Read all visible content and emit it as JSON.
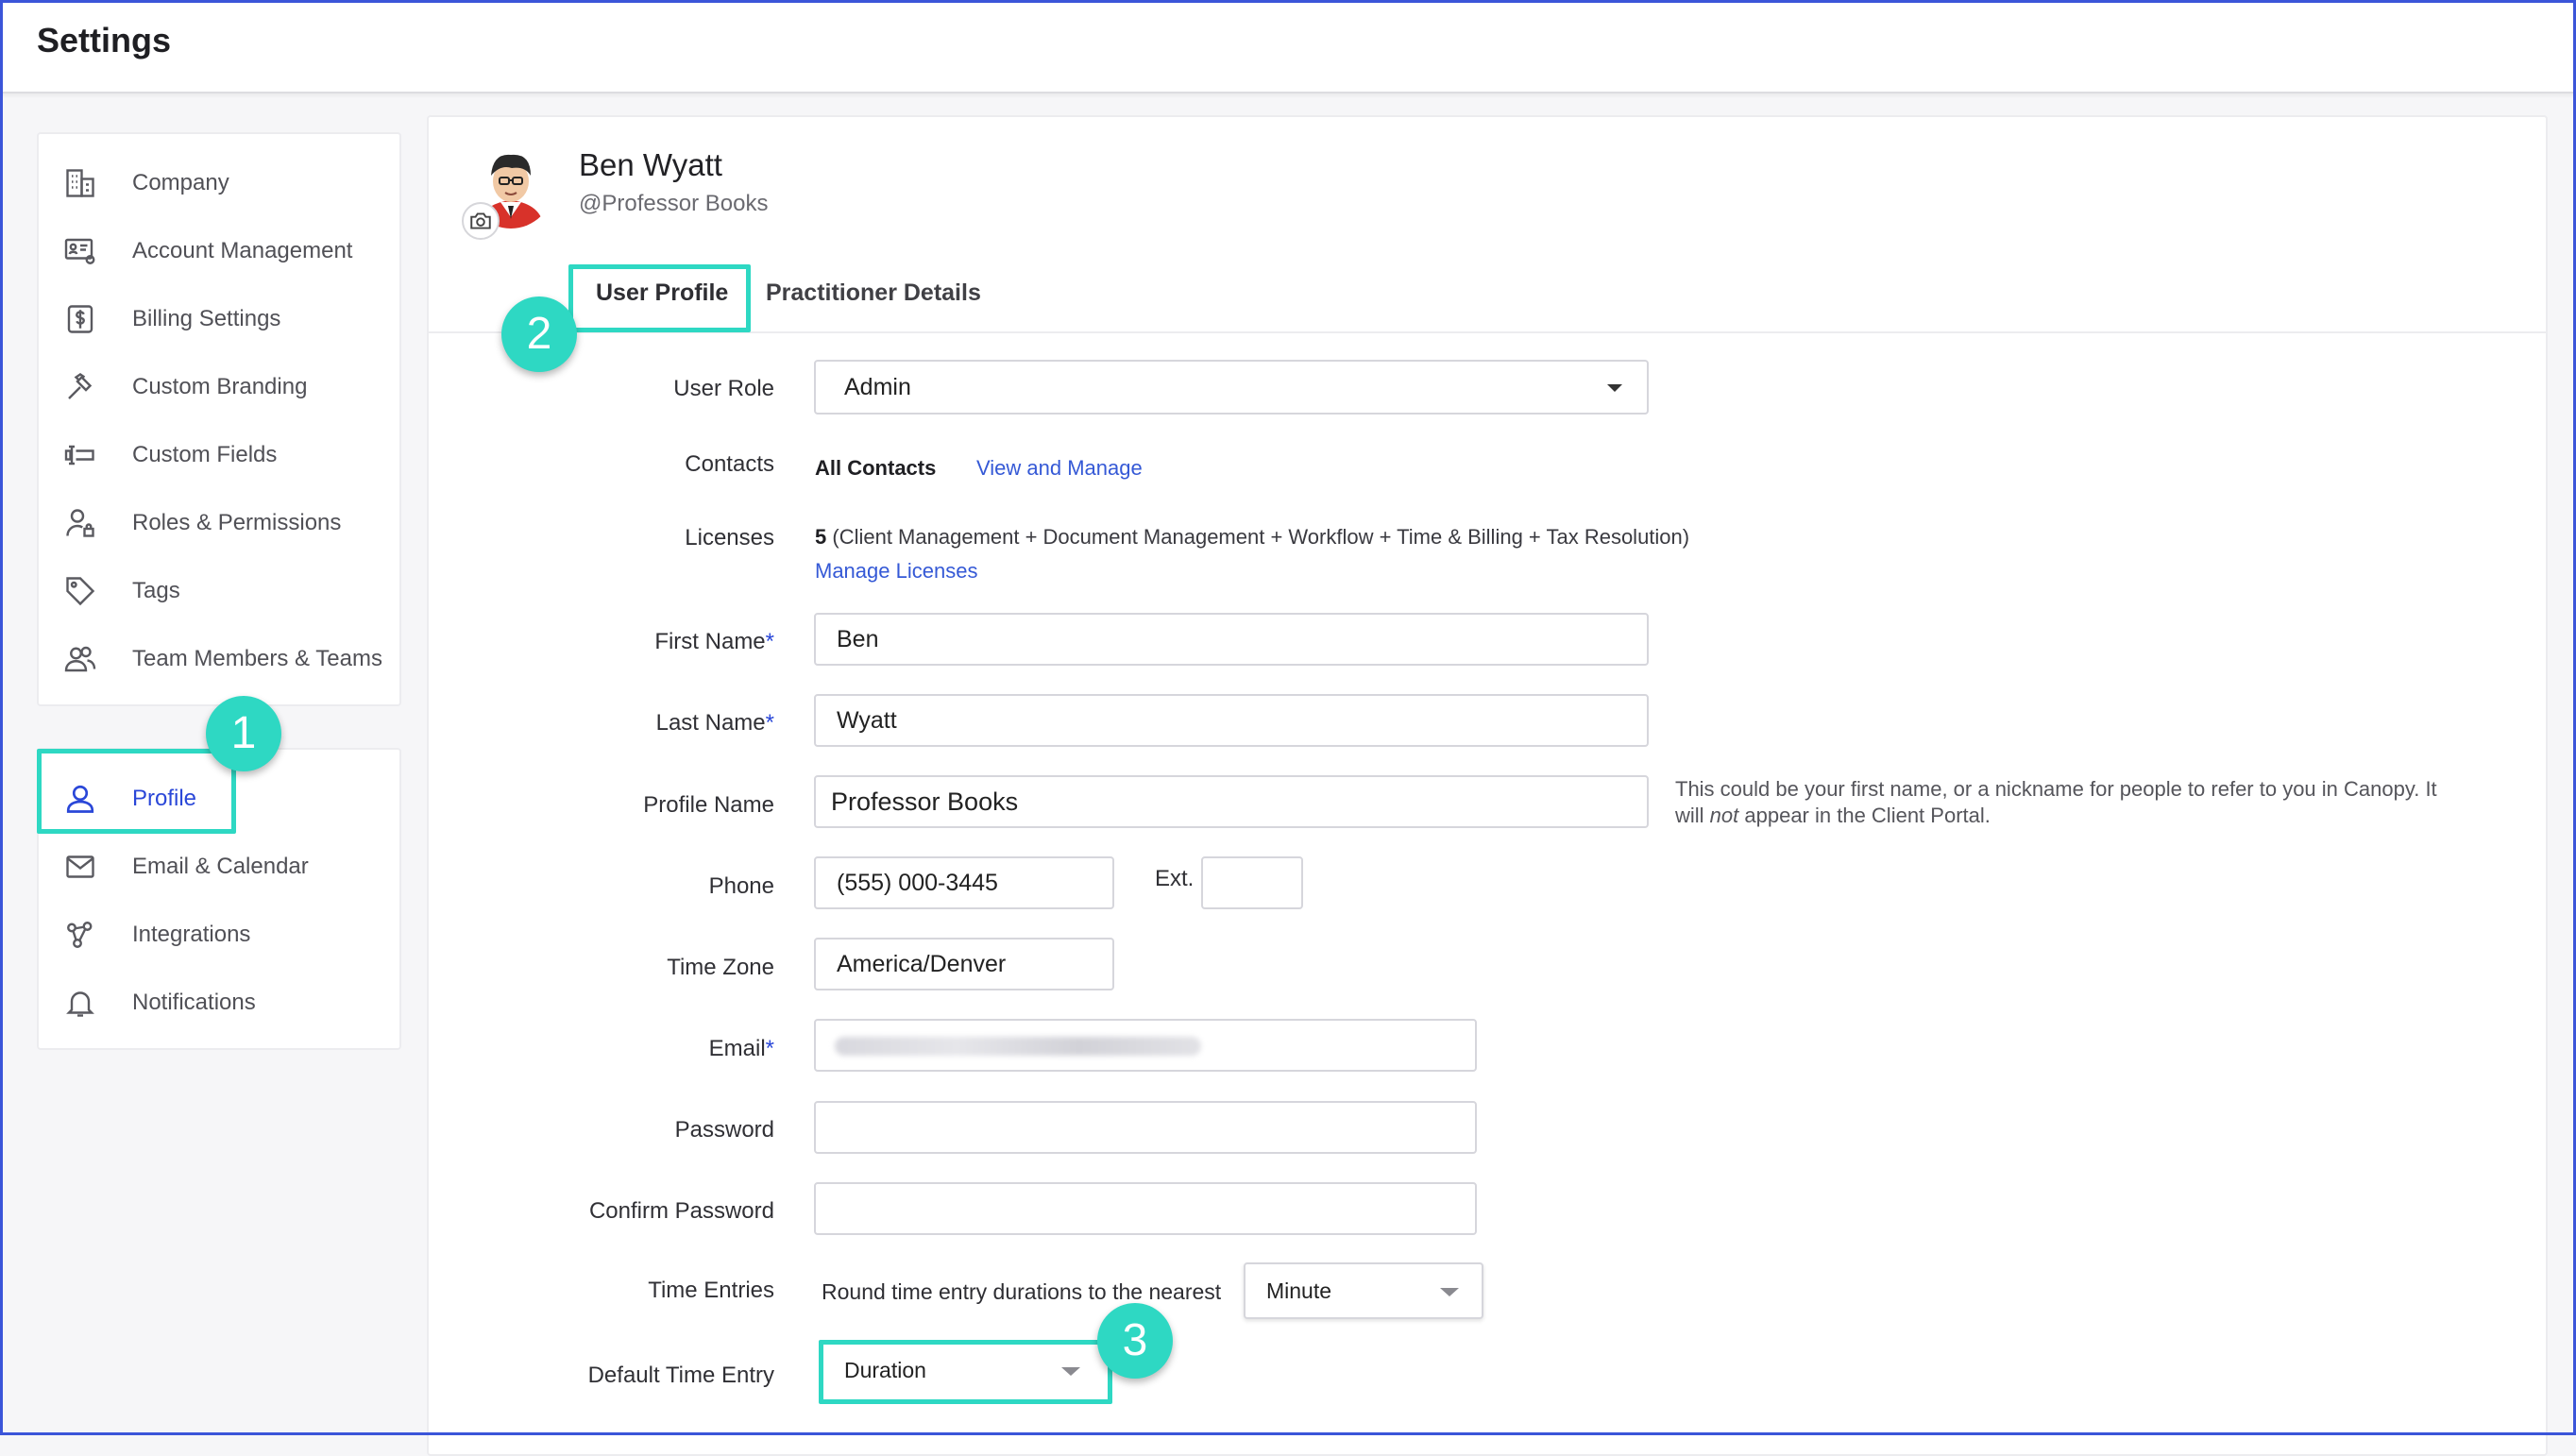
{
  "header": {
    "title": "Settings"
  },
  "sidebar": {
    "group1": [
      {
        "label": "Company",
        "icon": "building-icon"
      },
      {
        "label": "Account Management",
        "icon": "id-card-gear-icon"
      },
      {
        "label": "Billing Settings",
        "icon": "dollar-icon"
      },
      {
        "label": "Custom Branding",
        "icon": "hammer-icon"
      },
      {
        "label": "Custom Fields",
        "icon": "text-field-icon"
      },
      {
        "label": "Roles & Permissions",
        "icon": "user-lock-icon"
      },
      {
        "label": "Tags",
        "icon": "tag-icon"
      },
      {
        "label": "Team Members & Teams",
        "icon": "users-icon"
      }
    ],
    "group2": [
      {
        "label": "Profile",
        "icon": "user-icon",
        "active": true
      },
      {
        "label": "Email & Calendar",
        "icon": "envelope-icon"
      },
      {
        "label": "Integrations",
        "icon": "integrations-icon"
      },
      {
        "label": "Notifications",
        "icon": "bell-icon"
      }
    ]
  },
  "profile": {
    "name": "Ben Wyatt",
    "handle": "@Professor Books"
  },
  "tabs": [
    {
      "label": "User Profile",
      "active": true
    },
    {
      "label": "Practitioner Details"
    }
  ],
  "callouts": [
    "1",
    "2",
    "3"
  ],
  "form": {
    "user_role": {
      "label": "User Role",
      "value": "Admin"
    },
    "contacts": {
      "label": "Contacts",
      "value": "All Contacts",
      "link": "View and Manage"
    },
    "licenses": {
      "label": "Licenses",
      "count": "5",
      "detail": "(Client Management + Document Management + Workflow + Time & Billing + Tax Resolution)",
      "link": "Manage Licenses"
    },
    "first_name": {
      "label": "First Name",
      "required": "*",
      "value": "Ben"
    },
    "last_name": {
      "label": "Last Name",
      "required": "*",
      "value": "Wyatt"
    },
    "profile_name": {
      "label": "Profile Name",
      "value": "Professor Books",
      "hint_a": "This could be your first name, or a nickname for people to refer to you in Canopy. It",
      "hint_b1": "will ",
      "hint_em": "not",
      "hint_b2": " appear in the Client Portal."
    },
    "phone": {
      "label": "Phone",
      "value": "(555) 000-3445",
      "ext_label": "Ext.",
      "ext_value": ""
    },
    "time_zone": {
      "label": "Time Zone",
      "value": "America/Denver"
    },
    "email": {
      "label": "Email",
      "required": "*"
    },
    "password": {
      "label": "Password",
      "value": ""
    },
    "confirm_password": {
      "label": "Confirm Password",
      "value": ""
    },
    "time_entries": {
      "label": "Time Entries",
      "text": "Round time entry durations to the nearest",
      "value": "Minute"
    },
    "default_time_entry": {
      "label": "Default Time Entry",
      "value": "Duration"
    }
  },
  "colors": {
    "accent": "#2a47d8",
    "callout": "#2ed8c3",
    "link": "#3559d6",
    "frame": "#3b55d9"
  }
}
